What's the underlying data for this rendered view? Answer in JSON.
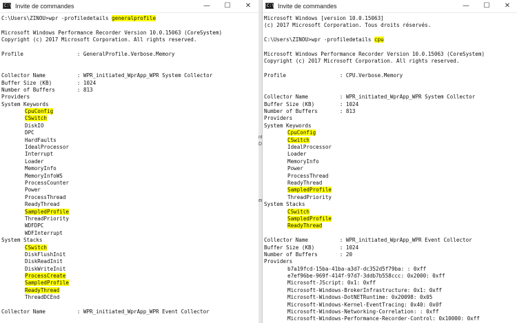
{
  "colors": {
    "highlight": "#ffff00",
    "console_bg": "#ffffff",
    "text": "#111111"
  },
  "left_window": {
    "title": "Invite de commandes",
    "icon": "cmd-icon",
    "controls": {
      "minimize": "—",
      "maximize": "☐",
      "close": "✕"
    },
    "lines": [
      {
        "text": "C:\\Users\\ZINOU>wpr -profiledetails ",
        "hl": "generalprofile"
      },
      {
        "text": "",
        "hl": ""
      },
      {
        "text": "Microsoft Windows Performance Recorder Version 10.0.15063 (CoreSystem)",
        "hl": ""
      },
      {
        "text": "Copyright (c) 2017 Microsoft Corporation. All rights reserved.",
        "hl": ""
      },
      {
        "text": "",
        "hl": ""
      },
      {
        "text": "Profile                 : GeneralProfile.Verbose.Memory",
        "hl": ""
      },
      {
        "text": "",
        "hl": ""
      },
      {
        "text": "",
        "hl": ""
      },
      {
        "text": "Collector Name          : WPR_initiated_WprApp_WPR System Collector",
        "hl": ""
      },
      {
        "text": "Buffer Size (KB)        : 1024",
        "hl": ""
      },
      {
        "text": "Number of Buffers       : 813",
        "hl": ""
      },
      {
        "text": "Providers",
        "hl": ""
      },
      {
        "text": "System Keywords",
        "hl": ""
      },
      {
        "text": "",
        "hl": "CpuConfig",
        "indent": true
      },
      {
        "text": "",
        "hl": "CSwitch",
        "indent": true
      },
      {
        "text": "DiskIO",
        "hl": "",
        "indent": true
      },
      {
        "text": "DPC",
        "hl": "",
        "indent": true
      },
      {
        "text": "HardFaults",
        "hl": "",
        "indent": true
      },
      {
        "text": "IdealProcessor",
        "hl": "",
        "indent": true
      },
      {
        "text": "Interrupt",
        "hl": "",
        "indent": true
      },
      {
        "text": "Loader",
        "hl": "",
        "indent": true
      },
      {
        "text": "MemoryInfo",
        "hl": "",
        "indent": true
      },
      {
        "text": "MemoryInfoWS",
        "hl": "",
        "indent": true
      },
      {
        "text": "ProcessCounter",
        "hl": "",
        "indent": true
      },
      {
        "text": "Power",
        "hl": "",
        "indent": true
      },
      {
        "text": "ProcessThread",
        "hl": "",
        "indent": true
      },
      {
        "text": "ReadyThread",
        "hl": "",
        "indent": true
      },
      {
        "text": "",
        "hl": "SampledProfile",
        "indent": true
      },
      {
        "text": "ThreadPriority",
        "hl": "",
        "indent": true
      },
      {
        "text": "WDFDPC",
        "hl": "",
        "indent": true
      },
      {
        "text": "WDFInterrupt",
        "hl": "",
        "indent": true
      },
      {
        "text": "System Stacks",
        "hl": ""
      },
      {
        "text": "",
        "hl": "CSwitch",
        "indent": true
      },
      {
        "text": "DiskFlushInit",
        "hl": "",
        "indent": true
      },
      {
        "text": "DiskReadInit",
        "hl": "",
        "indent": true
      },
      {
        "text": "DiskWriteInit",
        "hl": "",
        "indent": true
      },
      {
        "text": "",
        "hl": "ProcessCreate",
        "indent": true
      },
      {
        "text": "",
        "hl": "SampledProfile",
        "indent": true
      },
      {
        "text": "",
        "hl": "ReadyThread",
        "indent": true
      },
      {
        "text": "ThreadDCEnd",
        "hl": "",
        "indent": true
      },
      {
        "text": "",
        "hl": ""
      },
      {
        "text": "Collector Name          : WPR_initiated_WprApp_WPR Event Collector",
        "hl": ""
      }
    ]
  },
  "right_window": {
    "title": "Invite de commandes",
    "icon": "cmd-icon",
    "controls": {
      "minimize": "—",
      "maximize": "☐",
      "close": "✕"
    },
    "lines": [
      {
        "text": "Microsoft Windows [version 10.0.15063]",
        "hl": ""
      },
      {
        "text": "(c) 2017 Microsoft Corporation. Tous droits réservés.",
        "hl": ""
      },
      {
        "text": "",
        "hl": ""
      },
      {
        "text": "C:\\Users\\ZINOU>wpr -profiledetails ",
        "hl": "cpu"
      },
      {
        "text": "",
        "hl": ""
      },
      {
        "text": "Microsoft Windows Performance Recorder Version 10.0.15063 (CoreSystem)",
        "hl": ""
      },
      {
        "text": "Copyright (c) 2017 Microsoft Corporation. All rights reserved.",
        "hl": ""
      },
      {
        "text": "",
        "hl": ""
      },
      {
        "text": "Profile                 : CPU.Verbose.Memory",
        "hl": ""
      },
      {
        "text": "",
        "hl": ""
      },
      {
        "text": "",
        "hl": ""
      },
      {
        "text": "Collector Name          : WPR_initiated_WprApp_WPR System Collector",
        "hl": ""
      },
      {
        "text": "Buffer Size (KB)        : 1024",
        "hl": ""
      },
      {
        "text": "Number of Buffers       : 813",
        "hl": ""
      },
      {
        "text": "Providers",
        "hl": ""
      },
      {
        "text": "System Keywords",
        "hl": ""
      },
      {
        "text": "",
        "hl": "CpuConfig",
        "indent": true
      },
      {
        "text": "",
        "hl": "CSwitch",
        "indent": true
      },
      {
        "text": "IdealProcessor",
        "hl": "",
        "indent": true
      },
      {
        "text": "Loader",
        "hl": "",
        "indent": true
      },
      {
        "text": "MemoryInfo",
        "hl": "",
        "indent": true
      },
      {
        "text": "Power",
        "hl": "",
        "indent": true
      },
      {
        "text": "ProcessThread",
        "hl": "",
        "indent": true
      },
      {
        "text": "ReadyThread",
        "hl": "",
        "indent": true
      },
      {
        "text": "",
        "hl": "SampledProfile",
        "indent": true
      },
      {
        "text": "ThreadPriority",
        "hl": "",
        "indent": true
      },
      {
        "text": "System Stacks",
        "hl": ""
      },
      {
        "text": "",
        "hl": "CSwitch",
        "indent": true
      },
      {
        "text": "",
        "hl": "SampledProfile",
        "indent": true
      },
      {
        "text": "",
        "hl": "ReadyThread",
        "indent": true
      },
      {
        "text": "",
        "hl": ""
      },
      {
        "text": "Collector Name          : WPR_initiated_WprApp_WPR Event Collector",
        "hl": ""
      },
      {
        "text": "Buffer Size (KB)        : 1024",
        "hl": ""
      },
      {
        "text": "Number of Buffers       : 20",
        "hl": ""
      },
      {
        "text": "Providers",
        "hl": ""
      },
      {
        "text": "b7a19fcd-15ba-41ba-a3d7-dc352d5f79ba: : 0xff",
        "hl": "",
        "indent": true
      },
      {
        "text": "e7ef96be-969f-414f-97d7-3ddb7b558ccc: 0x2000: 0xff",
        "hl": "",
        "indent": true
      },
      {
        "text": "Microsoft-JScript: 0x1: 0xff",
        "hl": "",
        "indent": true
      },
      {
        "text": "Microsoft-Windows-BrokerInfrastructure: 0x1: 0xff",
        "hl": "",
        "indent": true
      },
      {
        "text": "Microsoft-Windows-DotNETRuntime: 0x20098: 0x05",
        "hl": "",
        "indent": true
      },
      {
        "text": "Microsoft-Windows-Kernel-EventTracing: 0x40: 0x0f",
        "hl": "",
        "indent": true
      },
      {
        "text": "Microsoft-Windows-Networking-Correlation: : 0xff",
        "hl": "",
        "indent": true
      },
      {
        "text": "Microsoft-Windows-Performance-Recorder-Control: 0x10000: 0xff",
        "hl": "",
        "indent": true
      }
    ]
  },
  "background_window": {
    "peek_text": [
      "nfo",
      "Di",
      "ers"
    ]
  }
}
